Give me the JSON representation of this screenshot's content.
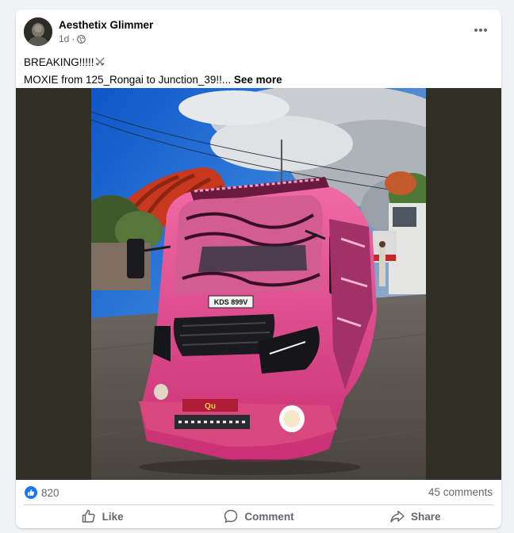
{
  "post": {
    "author": "Aesthetix Glimmer",
    "time": "1d",
    "separator": "·",
    "privacy_icon": "globe-icon",
    "more_icon": "more-options-icon",
    "text_line1": "BREAKING!!!!!",
    "text_line1_icon": "crossed-swords-icon",
    "text_line2": "MOXIE from 125_Rongai to Junction_39!!...",
    "see_more": "See more",
    "photo_plate": "KDS 899V"
  },
  "reactions": {
    "icon": "like-reaction-icon",
    "count": "820",
    "comments": "45 comments",
    "accent": "#1877f2"
  },
  "actions": {
    "like_label": "Like",
    "comment_label": "Comment",
    "share_label": "Share"
  },
  "colors": {
    "accent": "#1877f2",
    "secondary_text": "#65676b",
    "media_backdrop": "#312f25",
    "bus_pink": "#e8458f"
  }
}
